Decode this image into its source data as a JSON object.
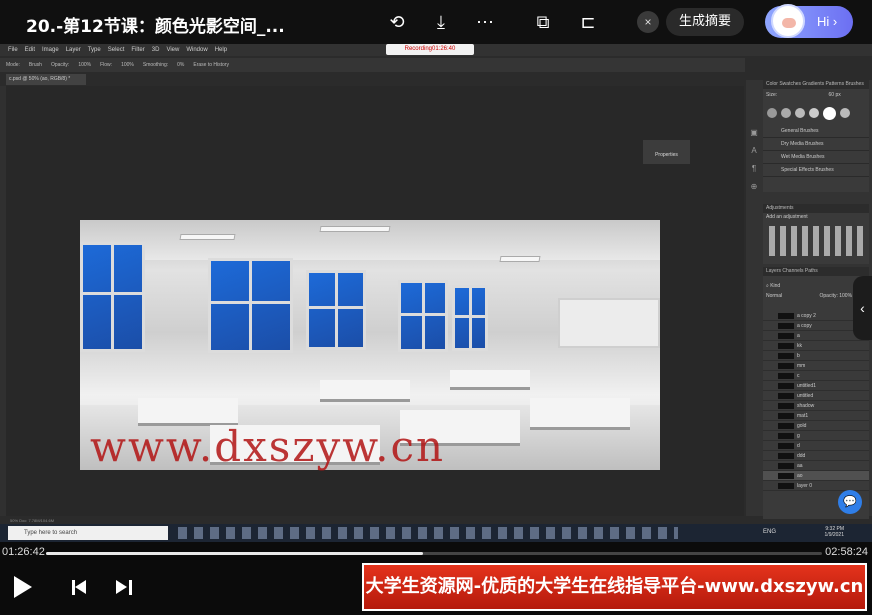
{
  "video": {
    "title": "20.-第12节课：颜色光影空间_...",
    "summary_label": "生成摘要",
    "assistant_label": "Hi",
    "close_icon": "×",
    "current_time": "01:26:42",
    "total_time": "02:58:24",
    "progress": 0.486
  },
  "photoshop": {
    "menu": [
      "File",
      "Edit",
      "Image",
      "Layer",
      "Type",
      "Select",
      "Filter",
      "3D",
      "View",
      "Window",
      "Help"
    ],
    "recording": "Recording01:26:40",
    "options": [
      "Mode:",
      "Brush",
      "Opacity:",
      "100%",
      "Flow:",
      "100%",
      "Smoothing:",
      "0%",
      "Erase to History"
    ],
    "doc_tab": "c.psd @ 50% (ao, RGB/8) *",
    "properties_label": "Properties",
    "panel_tabs": "Color  Swatches  Gradients  Patterns  Brushes",
    "size_label": "Size:",
    "size_value": "60 px",
    "brush_groups": [
      "General Brushes",
      "Dry Media Brushes",
      "Wet Media Brushes",
      "Special Effects Brushes"
    ],
    "adjustments_title": "Adjustments",
    "add_adjustment": "Add an adjustment",
    "layers_tabs": "Layers  Channels  Paths",
    "blend_mode": "Normal",
    "opacity_label": "Opacity: 100%",
    "layers": [
      "a copy 2",
      "a copy",
      "a",
      "kk",
      "b",
      "mm",
      "c",
      "untitled1",
      "untitled",
      "shadow",
      "mat1",
      "gold",
      "g",
      "d",
      "ddd",
      "aa",
      "ao",
      "layer 0"
    ],
    "status": "50%    Doc: 7.78M/104.6M"
  },
  "watermark": "www.dxszyw.cn",
  "taskbar": {
    "search_placeholder": "Type here to search",
    "clock": "9:32 PM",
    "date": "1/9/2021",
    "lang": "ENG"
  },
  "banner": "大学生资源网-优质的大学生在线指导平台-www.dxszyw.cn",
  "colors": {
    "accent": "#2f7ee8",
    "banner": "#d12a16"
  }
}
